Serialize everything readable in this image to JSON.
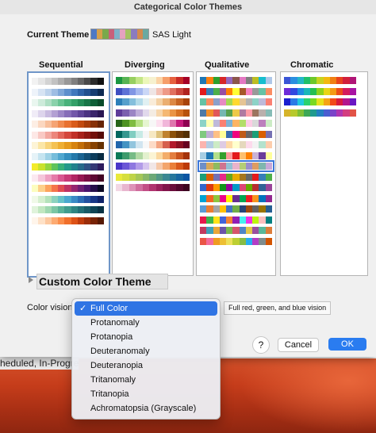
{
  "window": {
    "title": "Categorical Color Themes"
  },
  "current_theme": {
    "label": "Current Theme",
    "name": "SAS Light",
    "swatch": [
      "#4e79c5",
      "#d6a04a",
      "#79a94b",
      "#c9607a",
      "#7fb2c8",
      "#e4a2bf",
      "#a4c261",
      "#8a7bc0",
      "#d38a4e",
      "#6aa9a1"
    ]
  },
  "panels": [
    {
      "title": "Sequential",
      "selected": true,
      "rows": [
        [
          "#f2f2f2",
          "#e4e4e4",
          "#d3d3d3",
          "#c2c2c2",
          "#aeaeae",
          "#989898",
          "#7f7f7f",
          "#666666",
          "#4a4a4a",
          "#2b2b2b",
          "#111111"
        ],
        [
          "#eef3fa",
          "#d6e3f3",
          "#bcd2ec",
          "#9ebde3",
          "#7ea7d8",
          "#5d8fcc",
          "#4178bd",
          "#2f63a8",
          "#22508f",
          "#173d72",
          "#0d2a52"
        ],
        [
          "#e9f6ef",
          "#cdebda",
          "#aedfc4",
          "#8ad2ab",
          "#67c392",
          "#48b27b",
          "#33a068",
          "#238b57",
          "#177547",
          "#0e5f37",
          "#084a29"
        ],
        [
          "#f0ecf7",
          "#ddd4ec",
          "#c9bbe0",
          "#b3a0d3",
          "#9c86c6",
          "#866db8",
          "#7257a9",
          "#5e4497",
          "#4b3382",
          "#39246b",
          "#291653"
        ],
        [
          "#fdeee4",
          "#fbd7c0",
          "#f8bf9b",
          "#f5a474",
          "#f08a4f",
          "#e87130",
          "#d95c1b",
          "#c24b10",
          "#a63d0b",
          "#873108",
          "#662405"
        ],
        [
          "#fde8e6",
          "#f9c9c4",
          "#f3a8a0",
          "#ec867c",
          "#e2655a",
          "#d4473d",
          "#c13028",
          "#a8221b",
          "#8e1812",
          "#72110c",
          "#560b07"
        ],
        [
          "#fdf4d6",
          "#fbe6a6",
          "#f8d47a",
          "#f4c253",
          "#eeae33",
          "#e59a1d",
          "#d6830f",
          "#c16d08",
          "#a65705",
          "#874303",
          "#663102"
        ],
        [
          "#e6f3f8",
          "#c5e4f0",
          "#9fd2e6",
          "#76bddb",
          "#50a7cf",
          "#3590bf",
          "#2579aa",
          "#1b6391",
          "#134f76",
          "#0d3d5c",
          "#082b42"
        ],
        [
          "#f3eb2a",
          "#c9e22c",
          "#93d53f",
          "#5fc45c",
          "#37b07a",
          "#22998a",
          "#21818d",
          "#276a8a",
          "#2f5183",
          "#343775",
          "#2d1c5e"
        ],
        [
          "#fbe9f0",
          "#f5c6da",
          "#eea0c2",
          "#e57aa9",
          "#d95690",
          "#c83a78",
          "#b22563",
          "#971752",
          "#7b0e43",
          "#5e0833",
          "#430424"
        ],
        [
          "#fcfdbf",
          "#fdd08a",
          "#fca35d",
          "#f5744a",
          "#e04c53",
          "#be3364",
          "#962670",
          "#6f1f73",
          "#4a156b",
          "#26104a",
          "#0c0a24"
        ],
        [
          "#f0f9e8",
          "#d5efcf",
          "#b4e2bb",
          "#8cd2be",
          "#66c2c8",
          "#4aa8cf",
          "#3a8ac5",
          "#2d6db5",
          "#2351a0",
          "#193887",
          "#10246a"
        ],
        [
          "#e0f3db",
          "#c1e7c0",
          "#9fd8b0",
          "#7bc6a4",
          "#59b298",
          "#409c8e",
          "#2e8583",
          "#216f76",
          "#175a67",
          "#0f4556",
          "#083244"
        ],
        [
          "#fff5eb",
          "#fee1c7",
          "#fdc89f",
          "#fdab72",
          "#fb8e4b",
          "#f06f2b",
          "#dd5217",
          "#bf3c0d",
          "#9b2d09",
          "#782306",
          "#561904"
        ]
      ]
    },
    {
      "title": "Diverging",
      "selected": false,
      "rows": [
        [
          "#1a9641",
          "#58b453",
          "#97cf60",
          "#c4e687",
          "#ecf7b9",
          "#f6f1cf",
          "#fbd3a6",
          "#f69e69",
          "#e6603e",
          "#c82a26",
          "#a50026"
        ],
        [
          "#3e4fc1",
          "#5e72d6",
          "#8096e4",
          "#a6b9ef",
          "#cad7f6",
          "#eee5e5",
          "#f4c0b3",
          "#ee9987",
          "#e0705f",
          "#cb463c",
          "#b0231f"
        ],
        [
          "#2c7fb8",
          "#56a0cc",
          "#84bfdc",
          "#b3dbe9",
          "#e0f0f2",
          "#f9ecd9",
          "#f4d1a4",
          "#ebaf71",
          "#dc8844",
          "#c66321",
          "#a8430a"
        ],
        [
          "#5e3c99",
          "#7b5fae",
          "#9b85c4",
          "#bfaed9",
          "#e1d8ec",
          "#f4ece3",
          "#f7d6ac",
          "#f5b873",
          "#ea9445",
          "#d67123",
          "#b8520b"
        ],
        [
          "#276419",
          "#4d9221",
          "#7fbc41",
          "#b8e186",
          "#e6f5d0",
          "#f7f7f7",
          "#fde0ef",
          "#f1b6da",
          "#de77ae",
          "#c51b7d",
          "#8e0152"
        ],
        [
          "#01665e",
          "#35978f",
          "#80cdc1",
          "#c7eae5",
          "#f5f5f5",
          "#f6e8c3",
          "#dfc27d",
          "#bf812d",
          "#8c510a",
          "#6b3a07",
          "#543005"
        ],
        [
          "#2166ac",
          "#4393c3",
          "#92c5de",
          "#d1e5f0",
          "#f7f7f7",
          "#fddbc7",
          "#f4a582",
          "#d6604d",
          "#b2182b",
          "#8b0f22",
          "#67001f"
        ],
        [
          "#0c7a56",
          "#3d9b6c",
          "#77bb86",
          "#b2d9a5",
          "#e3f1ce",
          "#fbf4d4",
          "#fbd8a0",
          "#f3ad6a",
          "#e37e40",
          "#c9541e",
          "#a4330a"
        ],
        [
          "#4a36c8",
          "#6b55d6",
          "#8e77e0",
          "#b29be8",
          "#d6c4ef",
          "#f1e6e6",
          "#f6c8a8",
          "#f3a56c",
          "#ea7f3a",
          "#d8581b",
          "#bc3a08"
        ],
        [
          "#e9e93a",
          "#d5df3d",
          "#bed448",
          "#a4c757",
          "#88b868",
          "#6ca978",
          "#529987",
          "#3b8893",
          "#27779c",
          "#1766a1",
          "#0b55a3"
        ],
        [
          "#f2d7e4",
          "#e8b6cf",
          "#dd92b7",
          "#d06e9e",
          "#c24e86",
          "#b0336f",
          "#9a205c",
          "#82144b",
          "#6a0c3b",
          "#52062d",
          "#3c0320"
        ]
      ]
    },
    {
      "title": "Qualitative",
      "selected": false,
      "rows": [
        [
          "#1f77b4",
          "#ff7f0e",
          "#2ca02c",
          "#d62728",
          "#9467bd",
          "#8c564b",
          "#e377c2",
          "#7f7f7f",
          "#bcbd22",
          "#17becf",
          "#aec7e8"
        ],
        [
          "#e41a1c",
          "#377eb8",
          "#4daf4a",
          "#984ea3",
          "#ff7f00",
          "#ffff33",
          "#a65628",
          "#f781bf",
          "#999999",
          "#66c2a5",
          "#fc8d62"
        ],
        [
          "#66c2a5",
          "#fc8d62",
          "#8da0cb",
          "#e78ac3",
          "#a6d854",
          "#ffd92f",
          "#e5c494",
          "#b3b3b3",
          "#8dd3c7",
          "#bebada",
          "#fb8072"
        ],
        [
          "#4e79a7",
          "#f28e2b",
          "#e15759",
          "#76b7b2",
          "#59a14f",
          "#edc948",
          "#b07aa1",
          "#ff9da7",
          "#9c755f",
          "#bab0ac",
          "#86bcb6"
        ],
        [
          "#8dd3c7",
          "#ffffb3",
          "#bebada",
          "#fb8072",
          "#80b1d3",
          "#fdb462",
          "#b3de69",
          "#fccde5",
          "#d9d9d9",
          "#bc80bd",
          "#ccebc5"
        ],
        [
          "#7fc97f",
          "#beaed4",
          "#fdc086",
          "#ffff99",
          "#386cb0",
          "#f0027f",
          "#bf5b17",
          "#666666",
          "#1b9e77",
          "#d95f02",
          "#7570b3"
        ],
        [
          "#fbb4ae",
          "#b3cde3",
          "#ccebc5",
          "#decbe4",
          "#fed9a6",
          "#ffffcc",
          "#e5d8bd",
          "#fddaec",
          "#f2f2f2",
          "#b3e2cd",
          "#fdcdac"
        ],
        [
          "#a6cee3",
          "#1f78b4",
          "#b2df8a",
          "#33a02c",
          "#fb9a99",
          "#e31a1c",
          "#fdbf6f",
          "#ff7f00",
          "#cab2d6",
          "#6a3d9a",
          "#ffff99"
        ],
        [
          "#6e8fc8",
          "#d8a85a",
          "#8fbb61",
          "#cf7590",
          "#93c1d4",
          "#e9b3cb",
          "#b4cd76",
          "#9b8ecb",
          "#de9c62",
          "#7fb6ae",
          "#c8a8d8"
        ],
        [
          "#1b9e77",
          "#d95f02",
          "#7570b3",
          "#e7298a",
          "#66a61e",
          "#e6ab02",
          "#a6761d",
          "#666666",
          "#e41a1c",
          "#377eb8",
          "#4daf4a"
        ],
        [
          "#3366cc",
          "#dc3912",
          "#ff9900",
          "#109618",
          "#990099",
          "#0099c6",
          "#dd4477",
          "#66aa00",
          "#b82e2e",
          "#316395",
          "#994499"
        ],
        [
          "#00a2d3",
          "#f26522",
          "#8dc63f",
          "#ec008c",
          "#fff200",
          "#662d91",
          "#00a651",
          "#ed1c24",
          "#f7941d",
          "#0072bc",
          "#92278f"
        ],
        [
          "#5b9bd5",
          "#ed7d31",
          "#a5a5a5",
          "#ffc000",
          "#4472c4",
          "#70ad47",
          "#264478",
          "#9e480e",
          "#636363",
          "#997300",
          "#255e91"
        ],
        [
          "#e6194b",
          "#3cb44b",
          "#ffe119",
          "#4363d8",
          "#f58231",
          "#911eb4",
          "#46f0f0",
          "#f032e6",
          "#bcf60c",
          "#fabebe",
          "#008080"
        ],
        [
          "#c23a5f",
          "#3fa0b8",
          "#e8a63a",
          "#6b54a8",
          "#79b84e",
          "#d5566b",
          "#4e86c6",
          "#e3c84a",
          "#9a4fa0",
          "#58b89a",
          "#dc7d3a"
        ],
        [
          "#ea5545",
          "#f46a9b",
          "#ef9b20",
          "#edbf33",
          "#ede15b",
          "#bdcf32",
          "#87bc45",
          "#27aeef",
          "#b33dc6",
          "#7f8c8d",
          "#d35400"
        ]
      ]
    },
    {
      "title": "Chromatic",
      "selected": false,
      "rows": [
        [
          "#3a55d6",
          "#2a8fe0",
          "#23b6c8",
          "#1fbf6a",
          "#6dc82a",
          "#c8d21f",
          "#f2b90f",
          "#f07f12",
          "#e8431c",
          "#d11f3a",
          "#b01577"
        ],
        [
          "#6c2bd9",
          "#3148e0",
          "#1d8ae3",
          "#17b7b9",
          "#25bf51",
          "#8fd11a",
          "#e9d514",
          "#f39a13",
          "#ec4c18",
          "#d41a5d",
          "#a814a4"
        ],
        [
          "#1a1fd0",
          "#2b7be6",
          "#21c7e0",
          "#2bd26e",
          "#7ad920",
          "#e8e11a",
          "#f5a414",
          "#f24a18",
          "#d81a3c",
          "#b3148d",
          "#6a17c4"
        ],
        [
          "#d6b42a",
          "#b7c92c",
          "#7ebf36",
          "#3da856",
          "#1f9a8e",
          "#237fc1",
          "#4a5ed1",
          "#7a44c9",
          "#b036b0",
          "#d33d80",
          "#e25347"
        ]
      ]
    }
  ],
  "custom_theme": {
    "label": "Custom Color Theme"
  },
  "color_vision": {
    "label": "Color vision",
    "hint": "Full red, green, and blue vision",
    "selected_index": 0,
    "options": [
      "Full Color",
      "Protanomaly",
      "Protanopia",
      "Deuteranomaly",
      "Deuteranopia",
      "Tritanomaly",
      "Tritanopia",
      "Achromatopsia (Grayscale)"
    ]
  },
  "buttons": {
    "help": "?",
    "cancel": "Cancel",
    "ok": "OK"
  },
  "background_window": {
    "text": "heduled, In-Progres"
  },
  "colors": {
    "accent": "#2a7cf0",
    "menu_highlight": "#2f74e4",
    "panel_selected_border": "#6f96c8"
  },
  "icons": {
    "disclosure": "disclosure-triangle-icon",
    "checkmark": "checkmark-icon"
  }
}
